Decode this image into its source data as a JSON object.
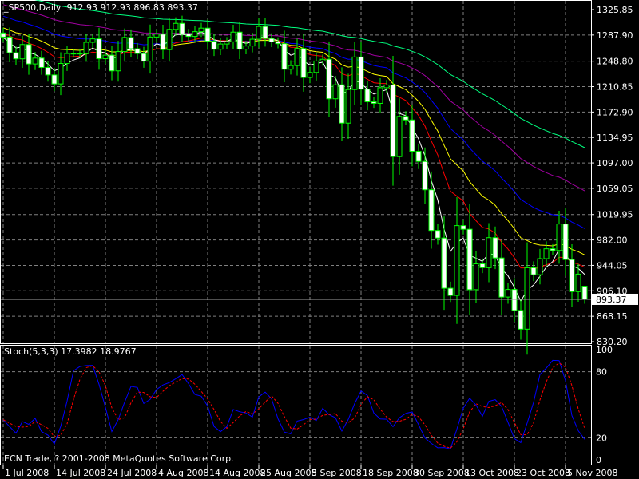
{
  "header": {
    "symbol": "_SP500,Daily",
    "ohlc": "912.93 912.93 896.83 893.37"
  },
  "sub_header": "Stoch(5,3,3) 17.3982 18.9767",
  "copyright": "ECN Trade, ? 2001-2008 MetaQuotes Software Corp.",
  "current_price": "893.37",
  "colors": {
    "bull": "#00ff00",
    "body": "#ffffff",
    "grid": "#808080",
    "stoch_main": "#0000ff",
    "stoch_signal": "#ff0000"
  },
  "chart_data": {
    "type": "candlestick",
    "price_ticks": [
      "1325.85",
      "1287.90",
      "1248.80",
      "1210.85",
      "1172.90",
      "1134.95",
      "1097.00",
      "1059.05",
      "1019.95",
      "982.00",
      "944.05",
      "906.10",
      "868.15",
      "830.20"
    ],
    "ylim": [
      830.2,
      1325.85
    ],
    "date_ticks": [
      {
        "label": "1 Jul 2008",
        "bar": 0
      },
      {
        "label": "14 Jul 2008",
        "bar": 8
      },
      {
        "label": "24 Jul 2008",
        "bar": 16
      },
      {
        "label": "4 Aug 2008",
        "bar": 24
      },
      {
        "label": "14 Aug 2008",
        "bar": 32
      },
      {
        "label": "25 Aug 2008",
        "bar": 40
      },
      {
        "label": "5 Sep 2008",
        "bar": 48
      },
      {
        "label": "18 Sep 2008",
        "bar": 56
      },
      {
        "label": "30 Sep 2008",
        "bar": 64
      },
      {
        "label": "13 Oct 2008",
        "bar": 72
      },
      {
        "label": "23 Oct 2008",
        "bar": 80
      },
      {
        "label": "5 Nov 2008",
        "bar": 88
      }
    ],
    "closes": [
      1284.9,
      1261.5,
      1252.3,
      1273.7,
      1244.7,
      1253.4,
      1239.5,
      1228.3,
      1214.9,
      1245.4,
      1260.3,
      1260.7,
      1260.0,
      1277.0,
      1282.2,
      1252.5,
      1257.8,
      1234.4,
      1263.2,
      1284.3,
      1267.4,
      1260.3,
      1249.0,
      1284.9,
      1289.2,
      1266.1,
      1296.3,
      1305.3,
      1289.6,
      1285.8,
      1292.9,
      1298.2,
      1278.6,
      1266.7,
      1274.5,
      1277.7,
      1292.2,
      1266.8,
      1271.5,
      1281.7,
      1300.7,
      1282.8,
      1277.6,
      1275.0,
      1236.8,
      1242.3,
      1267.8,
      1224.5,
      1232.0,
      1249.1,
      1251.7,
      1192.7,
      1213.6,
      1156.4,
      1206.5,
      1255.1,
      1207.1,
      1188.2,
      1185.9,
      1209.2,
      1213.3,
      1106.4,
      1166.4,
      1161.1,
      1114.3,
      1099.2,
      1056.9,
      996.2,
      984.9,
      909.9,
      899.2,
      1003.4,
      998.0,
      907.8,
      946.4,
      940.6,
      985.4,
      955.1,
      896.8,
      908.1,
      876.8,
      848.9,
      940.5,
      930.1,
      954.1,
      968.8,
      966.3,
      1005.8,
      952.8,
      904.9,
      931.0,
      912.9
    ],
    "last_bar": {
      "open": 912.93,
      "high": 912.93,
      "low": 886.83,
      "close": 893.37
    },
    "moving_averages": [
      {
        "period": 89,
        "seed": 1352,
        "color": "#00ff7f"
      },
      {
        "period": 55,
        "seed": 1335,
        "color": "#a000a0"
      },
      {
        "period": 34,
        "seed": 1318,
        "color": "#0000ff"
      },
      {
        "period": 21,
        "seed": 1300,
        "color": "#ffff00"
      },
      {
        "period": 13,
        "seed": 1292,
        "color": "#ff0000"
      },
      {
        "period": 5,
        "seed": 1284,
        "color": "#ffffff"
      }
    ],
    "stochastic": {
      "k": 5,
      "d": 3,
      "slowing": 3,
      "levels": [
        20,
        80
      ],
      "ticks": [
        "100",
        "80",
        "20",
        "0"
      ],
      "ylim": [
        0,
        100
      ]
    }
  }
}
